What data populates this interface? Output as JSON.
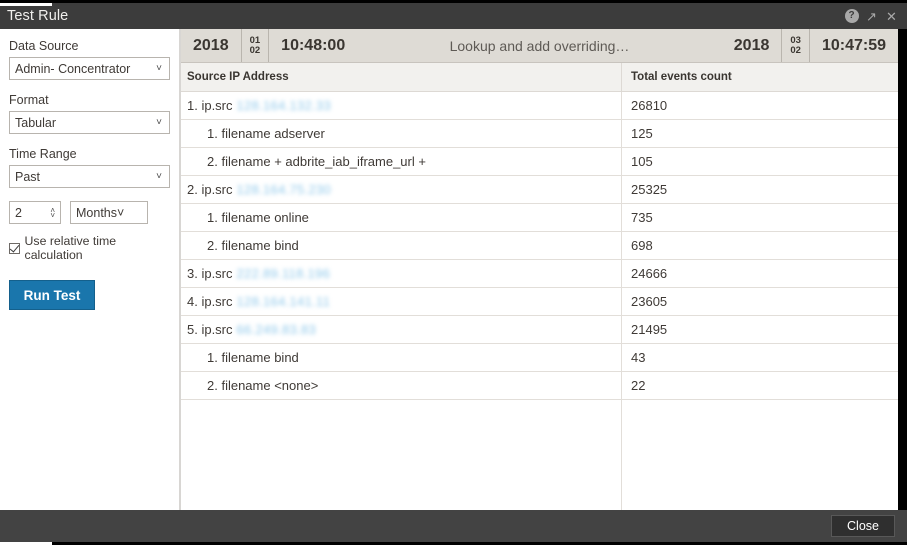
{
  "window": {
    "title": "Test Rule",
    "buttons": {
      "help": "?",
      "maximize": "↗",
      "close": "✕"
    }
  },
  "sidebar": {
    "data_source": {
      "label": "Data Source",
      "value": "Admin- Concentrator",
      "chevron": "˅"
    },
    "format": {
      "label": "Format",
      "value": "Tabular",
      "chevron": "˅"
    },
    "time_range": {
      "label": "Time Range",
      "value": "Past",
      "chevron": "˅"
    },
    "amount": {
      "value": "2",
      "up": "˄",
      "down": "˅"
    },
    "unit": {
      "value": "Months",
      "chevron": "˅"
    },
    "relative_time": {
      "label": "Use relative time calculation",
      "checked": true
    },
    "run_test_label": "Run Test"
  },
  "timebar": {
    "start": {
      "year": "2018",
      "date_top": "01",
      "date_bottom": "02",
      "time": "10:48:00"
    },
    "title": "Lookup and add overriding…",
    "end": {
      "year": "2018",
      "date_top": "03",
      "date_bottom": "02",
      "time": "10:47:59"
    }
  },
  "table": {
    "columns": [
      "Source IP Address",
      "Total events count"
    ],
    "rows": [
      {
        "level": 1,
        "label": "1. ip.src",
        "redacted": "128.164.132.33",
        "count": "26810"
      },
      {
        "level": 2,
        "label": "1. filename adserver",
        "redacted": "",
        "count": "125"
      },
      {
        "level": 2,
        "label": "2. filename + adbrite_iab_iframe_url +",
        "redacted": "",
        "count": "105"
      },
      {
        "level": 1,
        "label": "2. ip.src",
        "redacted": "128.164.75.230",
        "count": "25325"
      },
      {
        "level": 2,
        "label": "1. filename online",
        "redacted": "",
        "count": "735"
      },
      {
        "level": 2,
        "label": "2. filename bind",
        "redacted": "",
        "count": "698"
      },
      {
        "level": 1,
        "label": "3. ip.src",
        "redacted": "222.89.118.196",
        "count": "24666"
      },
      {
        "level": 1,
        "label": "4. ip.src",
        "redacted": "128.164.141.11",
        "count": "23605"
      },
      {
        "level": 1,
        "label": "5. ip.src",
        "redacted": "66.249.83.83",
        "count": "21495"
      },
      {
        "level": 2,
        "label": "1. filename bind",
        "redacted": "",
        "count": "43"
      },
      {
        "level": 2,
        "label": "2. filename <none>",
        "redacted": "",
        "count": "22"
      }
    ]
  },
  "footer": {
    "close_label": "Close"
  }
}
